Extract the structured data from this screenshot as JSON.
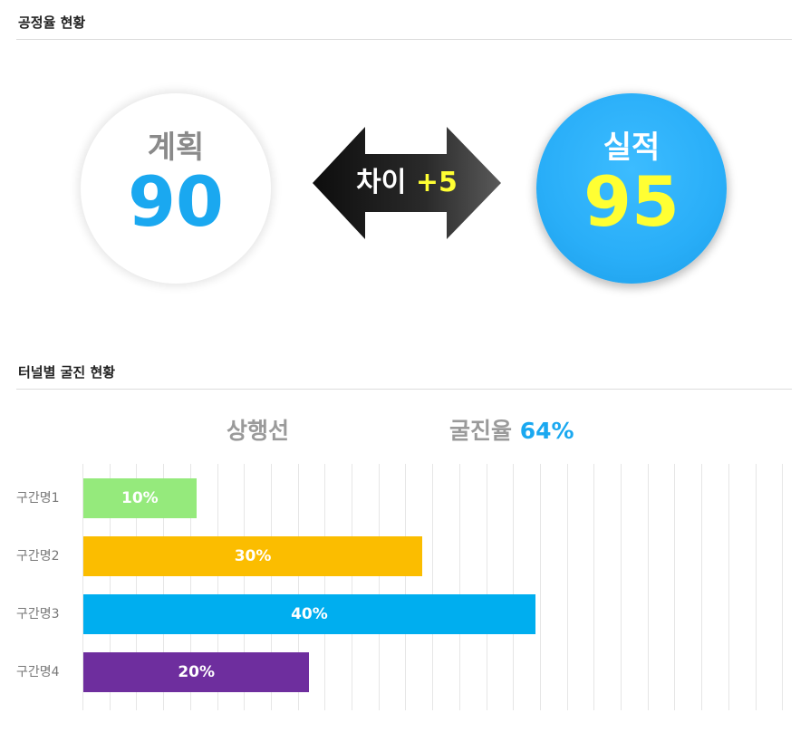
{
  "progress_section": {
    "title": "공정율 현황",
    "plan": {
      "label": "계획",
      "value": "90"
    },
    "actual": {
      "label": "실적",
      "value": "95"
    },
    "difference": {
      "label": "차이",
      "value": "+5"
    }
  },
  "tunnel_section": {
    "title": "터널별 굴진 현황",
    "line_name": "상행선",
    "rate_label": "굴진율",
    "rate_value": "64%"
  },
  "chart_data": {
    "type": "bar",
    "orientation": "horizontal",
    "categories": [
      "구간명1",
      "구간명2",
      "구간명3",
      "구간명4"
    ],
    "values": [
      10,
      30,
      40,
      20
    ],
    "value_labels": [
      "10%",
      "30%",
      "40%",
      "20%"
    ],
    "colors": [
      "#95ea7c",
      "#fbbd00",
      "#00aeef",
      "#6e2e9e"
    ],
    "xlim": [
      0,
      65
    ],
    "grid": true
  },
  "colors": {
    "accent": "#1aa8f0",
    "highlight": "#ffff33"
  }
}
